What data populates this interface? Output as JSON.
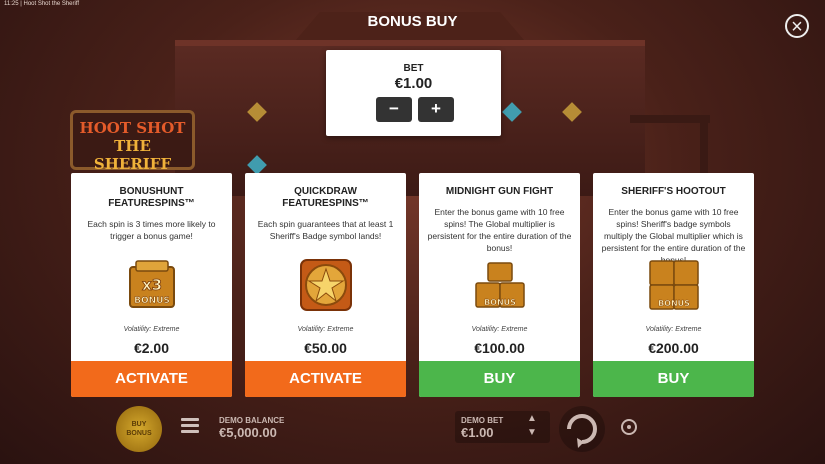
{
  "status_bar": {
    "time": "11:25",
    "app_name": "Hoot Shot the Sheriff"
  },
  "header": {
    "title": "BONUS BUY",
    "close_icon": "close-icon"
  },
  "bet": {
    "label": "BET",
    "value": "€1.00",
    "decrease": "−",
    "increase": "+"
  },
  "background_logo": {
    "line1": "HOOT SHOT",
    "line2": "THE SHERIFF"
  },
  "cards": [
    {
      "title": "BONUSHUNT FEATURESPINS™",
      "description": "Each spin is 3 times more likely to trigger a bonus game!",
      "icon": "x3-bonus-chest-icon",
      "icon_text": "x3",
      "icon_text2": "BONUS",
      "volatility": "Volatility: Extreme",
      "price": "€2.00",
      "button": "ACTIVATE",
      "button_color": "#f26a1b"
    },
    {
      "title": "QUICKDRAW FEATURESPINS™",
      "description": "Each spin guarantees that at least 1 Sheriff's Badge symbol lands!",
      "icon": "sheriff-badge-icon",
      "volatility": "Volatility: Extreme",
      "price": "€50.00",
      "button": "ACTIVATE",
      "button_color": "#f26a1b"
    },
    {
      "title": "MIDNIGHT GUN FIGHT",
      "description": "Enter the bonus game with 10 free spins! The Global multiplier is persistent for the entire duration of the bonus!",
      "icon": "bonus-chest-stack-icon",
      "icon_text": "BONUS",
      "volatility": "Volatility: Extreme",
      "price": "€100.00",
      "button": "BUY",
      "button_color": "#4cb64b"
    },
    {
      "title": "SHERIFF'S HOOTOUT",
      "description": "Enter the bonus game with 10 free spins! Sheriff's badge symbols multiply the Global multiplier which is persistent for the entire duration of the bonus!",
      "icon": "bonus-chest-quad-icon",
      "icon_text": "BONUS",
      "volatility": "Volatility: Extreme",
      "price": "€200.00",
      "button": "BUY",
      "button_color": "#4cb64b"
    }
  ],
  "bottom_bar": {
    "buy_bonus_line1": "BUY",
    "buy_bonus_line2": "BONUS",
    "balance_label": "DEMO BALANCE",
    "balance_value": "€5,000.00",
    "bet_label": "DEMO BET",
    "bet_value": "€1.00",
    "up_arrow": "▲",
    "down_arrow": "▼"
  }
}
